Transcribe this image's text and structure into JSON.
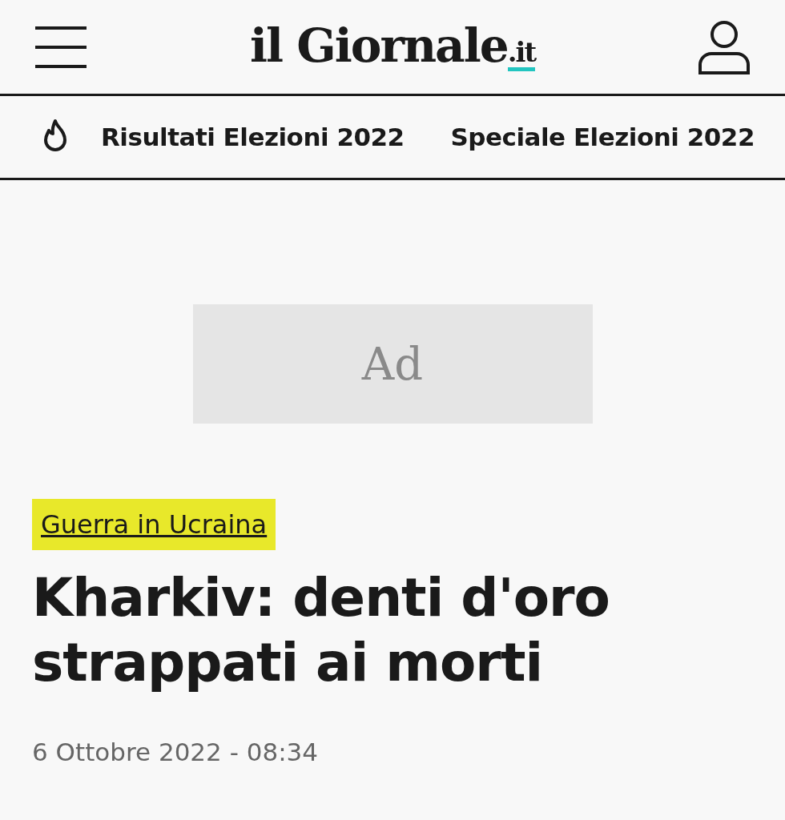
{
  "header": {
    "logo": {
      "name": "il Giornale",
      "suffix": ".it"
    }
  },
  "nav": {
    "items": [
      "Risultati Elezioni 2022",
      "Speciale Elezioni 2022"
    ]
  },
  "ad": {
    "label": "Ad"
  },
  "article": {
    "category": "Guerra in Ucraina",
    "title": "Kharkiv: denti d'oro strappati ai morti",
    "date": "6 Ottobre 2022 - 08:34"
  }
}
